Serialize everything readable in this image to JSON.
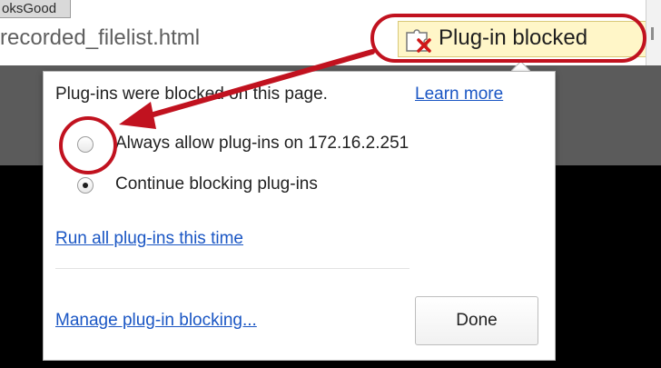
{
  "browser": {
    "tab_fragment": "oksGood",
    "address": "recorded_filelist.html"
  },
  "plugin_indicator": {
    "label": "Plug-in blocked",
    "icon": "puzzle-blocked-icon"
  },
  "bubble": {
    "message": "Plug-ins were blocked on this page.",
    "learn_more": "Learn more",
    "options": [
      {
        "label": "Always allow plug-ins on 172.16.2.251",
        "checked": false
      },
      {
        "label": "Continue blocking plug-ins",
        "checked": true
      }
    ],
    "run_all": "Run all plug-ins this time",
    "manage": "Manage plug-in blocking...",
    "done": "Done"
  },
  "annotations": {
    "color": "#c1121f"
  }
}
